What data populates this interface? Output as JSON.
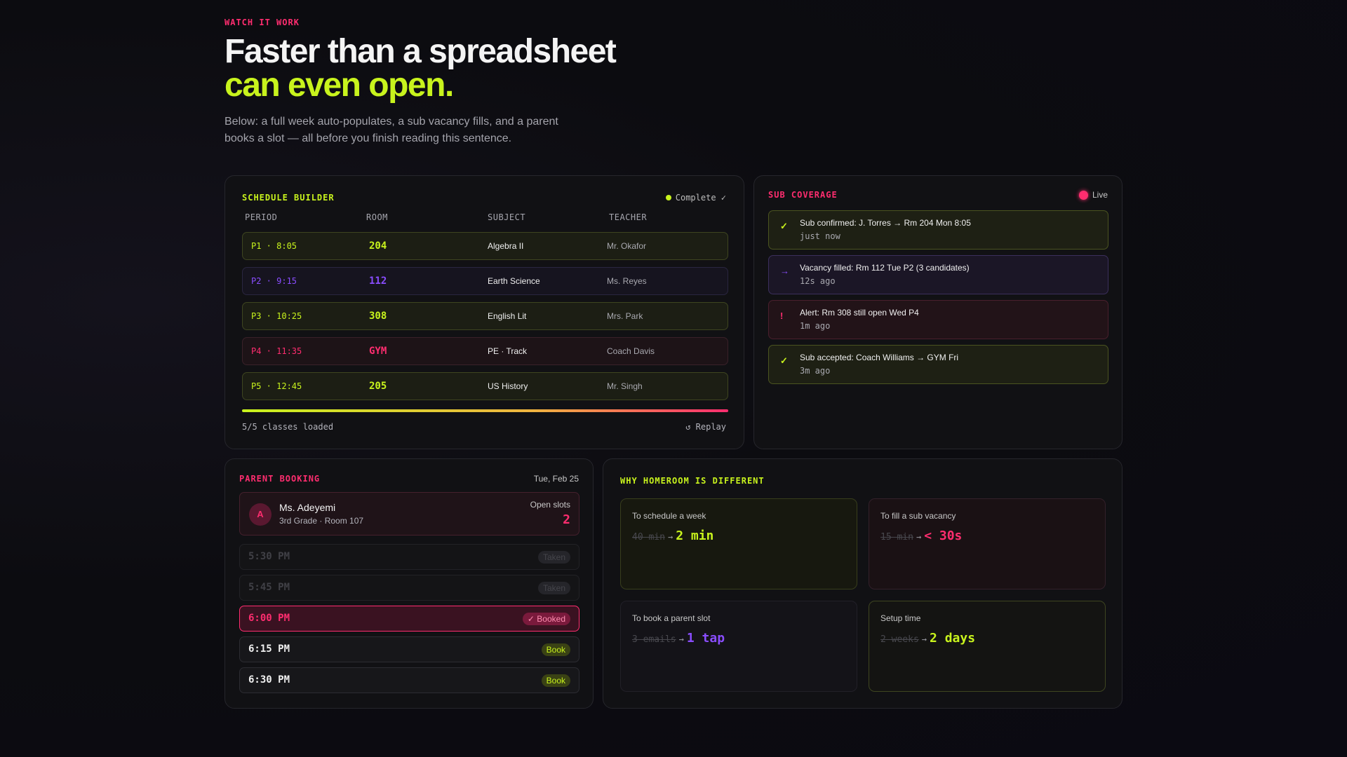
{
  "hero": {
    "eyebrow": "WATCH IT WORK",
    "title_line1": "Faster than a spreadsheet",
    "title_line2": "can even open.",
    "subtitle": "Below: a full week auto-populates, a sub vacancy fills, and a parent books a slot — all before you finish reading this sentence."
  },
  "schedule": {
    "title": "SCHEDULE BUILDER",
    "status": "Complete ✓",
    "columns": [
      "PERIOD",
      "ROOM",
      "SUBJECT",
      "TEACHER"
    ],
    "rows": [
      {
        "period": "P1 · 8:05",
        "room": "204",
        "subject": "Algebra II",
        "teacher": "Mr. Okafor"
      },
      {
        "period": "P2 · 9:15",
        "room": "112",
        "subject": "Earth Science",
        "teacher": "Ms. Reyes"
      },
      {
        "period": "P3 · 10:25",
        "room": "308",
        "subject": "English Lit",
        "teacher": "Mrs. Park"
      },
      {
        "period": "P4 · 11:35",
        "room": "GYM",
        "subject": "PE · Track",
        "teacher": "Coach Davis"
      },
      {
        "period": "P5 · 12:45",
        "room": "205",
        "subject": "US History",
        "teacher": "Mr. Singh"
      }
    ],
    "progress_fraction": 1.0,
    "loaded_text": "5/5 classes loaded",
    "replay_label": "↺ Replay"
  },
  "coverage": {
    "title": "SUB COVERAGE",
    "live_label": "Live",
    "feed": [
      {
        "icon": "✓",
        "text": "Sub confirmed: J. Torres → Rm 204 Mon 8:05",
        "time": "just now"
      },
      {
        "icon": "→",
        "text": "Vacancy filled: Rm 112 Tue P2 (3 candidates)",
        "time": "12s ago"
      },
      {
        "icon": "!",
        "text": "Alert: Rm 308 still open Wed P4",
        "time": "1m ago"
      },
      {
        "icon": "✓",
        "text": "Sub accepted: Coach Williams → GYM Fri",
        "time": "3m ago"
      }
    ]
  },
  "booking": {
    "title": "PARENT BOOKING",
    "date": "Tue, Feb 25",
    "teacher": {
      "initial": "A",
      "name": "Ms. Adeyemi",
      "meta": "3rd Grade · Room 107"
    },
    "open_slots_label": "Open slots",
    "open_slots_value": "2",
    "slots": [
      {
        "time": "5:30 PM",
        "badge": "Taken"
      },
      {
        "time": "5:45 PM",
        "badge": "Taken"
      },
      {
        "time": "6:00 PM",
        "badge": "✓ Booked"
      },
      {
        "time": "6:15 PM",
        "badge": "Book"
      },
      {
        "time": "6:30 PM",
        "badge": "Book"
      }
    ]
  },
  "why": {
    "title": "WHY HOMEROOM IS DIFFERENT",
    "stats": [
      {
        "label": "To schedule a week",
        "old": "40 min",
        "arrow": "→",
        "new": "2 min"
      },
      {
        "label": "To fill a sub vacancy",
        "old": "15 min",
        "arrow": "→",
        "new": "< 30s"
      },
      {
        "label": "To book a parent slot",
        "old": "3 emails",
        "arrow": "→",
        "new": "1 tap"
      },
      {
        "label": "Setup time",
        "old": "2 weeks",
        "arrow": "→",
        "new": "2 days"
      }
    ]
  },
  "colors": {
    "lime": "#c8f31d",
    "pink": "#ff2d6f",
    "purple": "#8a4dff",
    "background": "#0c0c10"
  }
}
